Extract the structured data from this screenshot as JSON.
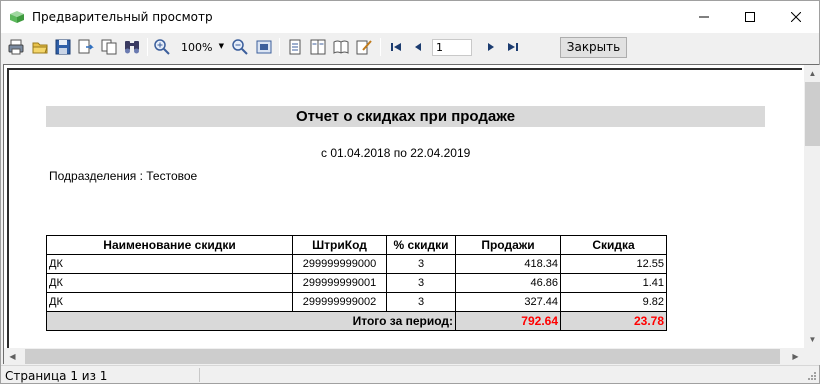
{
  "window": {
    "title": "Предварительный просмотр"
  },
  "toolbar": {
    "icons": [
      "print-icon",
      "open-icon",
      "save-icon",
      "export-icon",
      "copy-icon",
      "find-icon",
      "zoom-in-icon",
      "zoom-out-icon",
      "fit-page-icon",
      "single-page-icon",
      "two-page-icon",
      "book-icon",
      "edit-icon",
      "first-page-icon",
      "prev-page-icon",
      "next-page-icon",
      "last-page-icon"
    ],
    "zoom": "100%",
    "page": "1",
    "close_label": "Закрыть"
  },
  "report": {
    "title": "Отчет о скидках при продаже",
    "period": "с 01.04.2018 по 22.04.2019",
    "division": "Подразделения : Тестовое",
    "columns": [
      "Наименование скидки",
      "ШтриКод",
      "% скидки",
      "Продажи",
      "Скидка"
    ],
    "rows": [
      [
        "ДК",
        "299999999000",
        "3",
        "418.34",
        "12.55"
      ],
      [
        "ДК",
        "299999999001",
        "3",
        "46.86",
        "1.41"
      ],
      [
        "ДК",
        "299999999002",
        "3",
        "327.44",
        "9.82"
      ]
    ],
    "total_label": "Итого за  период:",
    "total_sales": "792.64",
    "total_discount": "23.78",
    "total_color": "#ff0000"
  },
  "status": {
    "text": "Страница 1 из 1"
  }
}
